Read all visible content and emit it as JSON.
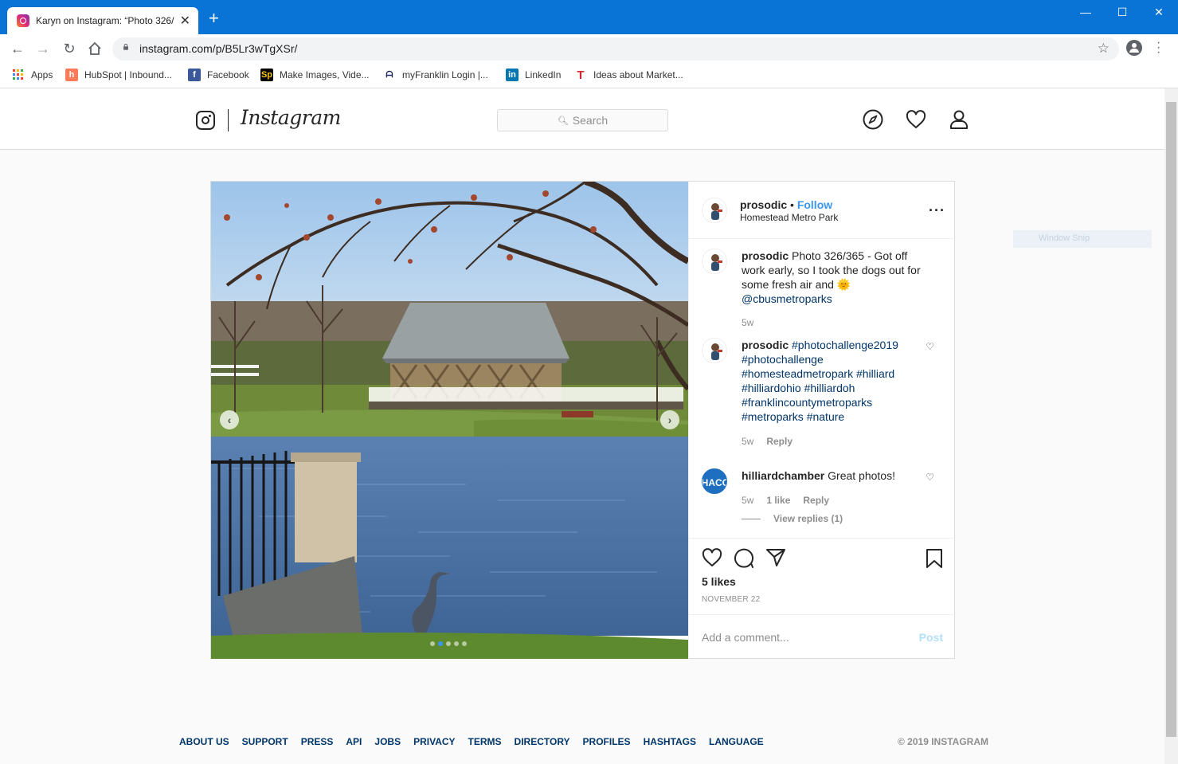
{
  "browser": {
    "tab_title": "Karyn on Instagram: “Photo 326/",
    "url": "instagram.com/p/B5Lr3wTgXSr/",
    "bookmarks": [
      {
        "label": "Apps",
        "icon": "apps-grid-icon",
        "color": "#e34133"
      },
      {
        "label": "HubSpot | Inbound...",
        "icon": "hubspot-icon",
        "color": "#ff7a59"
      },
      {
        "label": "Facebook",
        "icon": "facebook-icon",
        "color": "#3b5998"
      },
      {
        "label": "Make Images, Vide...",
        "icon": "spark-icon",
        "color": "#000000"
      },
      {
        "label": "myFranklin Login |...",
        "icon": "franklin-icon",
        "color": "#1d2a5a"
      },
      {
        "label": "LinkedIn",
        "icon": "linkedin-icon",
        "color": "#0077b5"
      },
      {
        "label": "Ideas about Market...",
        "icon": "t-icon",
        "color": "#d8232a"
      }
    ]
  },
  "instagram": {
    "wordmark": "Instagram",
    "search_placeholder": "Search",
    "post": {
      "username": "prosodic",
      "separator": "•",
      "follow_label": "Follow",
      "location": "Homestead Metro Park",
      "caption": {
        "user": "prosodic",
        "text": "Photo 326/365 - Got off work early, so I took the dogs out for some fresh air and",
        "emoji": "🌞",
        "mention": "@cbusmetroparks",
        "time": "5w"
      },
      "comments": [
        {
          "user": "prosodic",
          "hashtags": [
            "#photochallenge2019",
            "#photochallenge",
            "#homesteadmetropark",
            "#hilliard",
            "#hilliardohio",
            "#hilliardoh",
            "#franklincountymetroparks",
            "#metroparks",
            "#nature"
          ],
          "time": "5w",
          "reply_label": "Reply"
        },
        {
          "user": "hilliardchamber",
          "text": "Great photos!",
          "time": "5w",
          "likes": "1 like",
          "reply_label": "Reply",
          "view_replies": "View replies (1)",
          "avatar_text": "HACC"
        }
      ],
      "likes": "5 likes",
      "date": "NOVEMBER 22",
      "comment_placeholder": "Add a comment...",
      "post_label": "Post",
      "carousel": {
        "active_index": 1,
        "count": 5
      }
    },
    "footer": {
      "links": [
        "ABOUT US",
        "SUPPORT",
        "PRESS",
        "API",
        "JOBS",
        "PRIVACY",
        "TERMS",
        "DIRECTORY",
        "PROFILES",
        "HASHTAGS",
        "LANGUAGE"
      ],
      "copyright": "© 2019 INSTAGRAM"
    }
  },
  "overlay": {
    "window_snip": "Window Snip"
  }
}
